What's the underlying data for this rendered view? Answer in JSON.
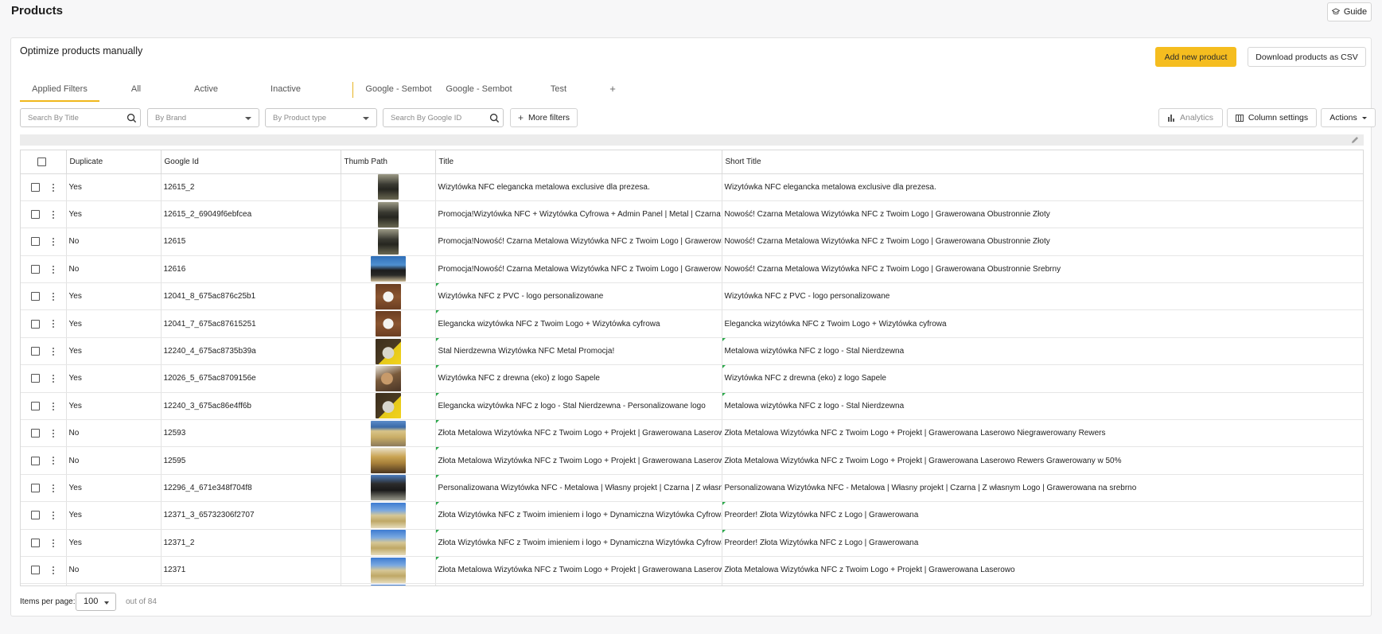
{
  "page": {
    "title": "Products",
    "guide_label": "Guide"
  },
  "card": {
    "title": "Optimize products manually",
    "add_button": "Add new product",
    "download_button": "Download products as CSV"
  },
  "tabs": [
    "Applied Filters",
    "All",
    "Active",
    "Inactive",
    "Google - Sembot",
    "Google - Sembot",
    "Test"
  ],
  "add_tab_label": "+",
  "filters": {
    "search_title_placeholder": "Search By Title",
    "brand_placeholder": "By Brand",
    "product_type_placeholder": "By Product type",
    "google_id_placeholder": "Search By Google ID",
    "more_filters": "More filters",
    "analytics": "Analytics",
    "column_settings": "Column settings",
    "actions": "Actions"
  },
  "table": {
    "columns": [
      "Duplicate",
      "Google Id",
      "Thumb Path",
      "Title",
      "Short Title"
    ],
    "rows": [
      {
        "dup": "Yes",
        "gid": "12615_2",
        "thumb": "metal-dark",
        "title": "Wizytówka NFC elegancka metalowa exclusive dla prezesa.",
        "short": "Wizytówka NFC elegancka metalowa exclusive dla prezesa.",
        "flag_title": false,
        "flag_short": false
      },
      {
        "dup": "Yes",
        "gid": "12615_2_69049f6ebfcea",
        "thumb": "metal-dark",
        "title": "Promocja!Wizytówka NFC + Wizytówka Cyfrowa + Admin Panel | Metal | Czarna",
        "short": "Nowość! Czarna Metalowa Wizytówka NFC z Twoim Logo | Grawerowana Obustronnie Złoty",
        "flag_title": false,
        "flag_short": false
      },
      {
        "dup": "No",
        "gid": "12615",
        "thumb": "metal-dark",
        "title": "Promocja!Nowość! Czarna Metalowa Wizytówka NFC z Twoim Logo | Grawerowana",
        "short": "Nowość! Czarna Metalowa Wizytówka NFC z Twoim Logo | Grawerowana Obustronnie Złoty",
        "flag_title": false,
        "flag_short": false
      },
      {
        "dup": "No",
        "gid": "12616",
        "thumb": "beach-dark",
        "title": "Promocja!Nowość! Czarna Metalowa Wizytówka NFC z Twoim Logo | Grawerowana",
        "short": "Nowość! Czarna Metalowa Wizytówka NFC z Twoim Logo | Grawerowana Obustronnie Srebrny",
        "flag_title": false,
        "flag_short": false
      },
      {
        "dup": "Yes",
        "gid": "12041_8_675ac876c25b1",
        "thumb": "pvc",
        "title": "Wizytówka NFC z PVC - logo personalizowane",
        "short": "Wizytówka NFC z PVC - logo personalizowane",
        "flag_title": true,
        "flag_short": false
      },
      {
        "dup": "Yes",
        "gid": "12041_7_675ac87615251",
        "thumb": "pvc",
        "title": "Elegancka wizytówka NFC z Twoim Logo + Wizytówka cyfrowa",
        "short": "Elegancka wizytówka NFC z Twoim Logo + Wizytówka cyfrowa",
        "flag_title": true,
        "flag_short": false
      },
      {
        "dup": "Yes",
        "gid": "12240_4_675ac8735b39a",
        "thumb": "steel-yellow",
        "title": "Stal Nierdzewna Wizytówka NFC Metal Promocja!",
        "short": "Metalowa wizytówka NFC z logo - Stal Nierdzewna",
        "flag_title": true,
        "flag_short": true
      },
      {
        "dup": "Yes",
        "gid": "12026_5_675ac8709156e",
        "thumb": "wood",
        "title": "Wizytówka NFC z drewna (eko) z logo Sapele",
        "short": "Wizytówka NFC z drewna (eko) z logo Sapele",
        "flag_title": true,
        "flag_short": true
      },
      {
        "dup": "Yes",
        "gid": "12240_3_675ac86e4ff6b",
        "thumb": "steel-yellow",
        "title": "Elegancka wizytówka NFC z logo - Stal Nierdzewna - Personalizowane logo",
        "short": "Metalowa wizytówka NFC z logo - Stal Nierdzewna",
        "flag_title": true,
        "flag_short": true
      },
      {
        "dup": "No",
        "gid": "12593",
        "thumb": "gold-beach",
        "title": "Złota Metalowa Wizytówka NFC z Twoim Logo + Projekt | Grawerowana Laserowo",
        "short": "Złota Metalowa Wizytówka NFC z Twoim Logo + Projekt | Grawerowana Laserowo Niegrawerowany Rewers",
        "flag_title": true,
        "flag_short": false
      },
      {
        "dup": "No",
        "gid": "12595",
        "thumb": "gold-table",
        "title": "Złota Metalowa Wizytówka NFC z Twoim Logo + Projekt | Grawerowana Laserowo",
        "short": "Złota Metalowa Wizytówka NFC z Twoim Logo + Projekt | Grawerowana Laserowo Rewers Grawerowany w 50%",
        "flag_title": true,
        "flag_short": false
      },
      {
        "dup": "Yes",
        "gid": "12296_4_671e348f704f8",
        "thumb": "black-beach",
        "title": "Personalizowana Wizytówka NFC - Metalowa | Własny projekt | Czarna | Z własnym Logo",
        "short": "Personalizowana Wizytówka NFC - Metalowa | Własny projekt | Czarna | Z własnym Logo | Grawerowana na srebrno",
        "flag_title": true,
        "flag_short": false
      },
      {
        "dup": "Yes",
        "gid": "12371_3_65732306f2707",
        "thumb": "gold-sky",
        "title": "Złota Wizytówka NFC z Twoim imieniem i logo + Dynamiczna Wizytówka Cyfrowa",
        "short": "Preorder! Złota Wizytówka NFC z Logo | Grawerowana",
        "flag_title": true,
        "flag_short": true
      },
      {
        "dup": "Yes",
        "gid": "12371_2",
        "thumb": "gold-sky",
        "title": "Złota Wizytówka NFC z Twoim imieniem i logo + Dynamiczna Wizytówka Cyfrowa",
        "short": "Preorder! Złota Wizytówka NFC z Logo | Grawerowana",
        "flag_title": true,
        "flag_short": true
      },
      {
        "dup": "No",
        "gid": "12371",
        "thumb": "gold-sky",
        "title": "Złota Metalowa Wizytówka NFC z Twoim Logo + Projekt | Grawerowana Laserowo",
        "short": "Złota Metalowa Wizytówka NFC z Twoim Logo + Projekt | Grawerowana Laserowo",
        "flag_title": true,
        "flag_short": false
      },
      {
        "dup": "",
        "gid": "",
        "thumb": "gold-sky",
        "title": "",
        "short": "",
        "flag_title": false,
        "flag_short": false
      }
    ]
  },
  "footer": {
    "items_per_page_label": "Items per page:",
    "per_page_value": "100",
    "out_of": "out of 84"
  },
  "colors": {
    "accent": "#f5bd1f",
    "flag": "#2aa84a"
  }
}
